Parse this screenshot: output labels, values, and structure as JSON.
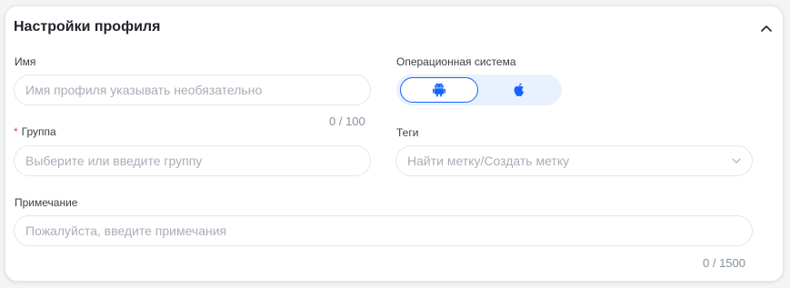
{
  "card": {
    "title": "Настройки профиля"
  },
  "name_field": {
    "label": "Имя",
    "placeholder": "Имя профиля указывать необязательно",
    "counter": "0 / 100"
  },
  "os_field": {
    "label": "Операционная система",
    "options": [
      {
        "icon": "android-icon",
        "selected": true
      },
      {
        "icon": "apple-icon",
        "selected": false
      }
    ],
    "accent": "#1664ff",
    "toggle_bg": "#e8f1fd"
  },
  "group_field": {
    "required_mark": "*",
    "label": "Группа",
    "placeholder": "Выберите или введите группу"
  },
  "tags_field": {
    "label": "Теги",
    "placeholder": "Найти метку/Создать метку"
  },
  "note_field": {
    "label": "Примечание",
    "placeholder": "Пожалуйста, введите примечания",
    "counter": "0 / 1500"
  }
}
